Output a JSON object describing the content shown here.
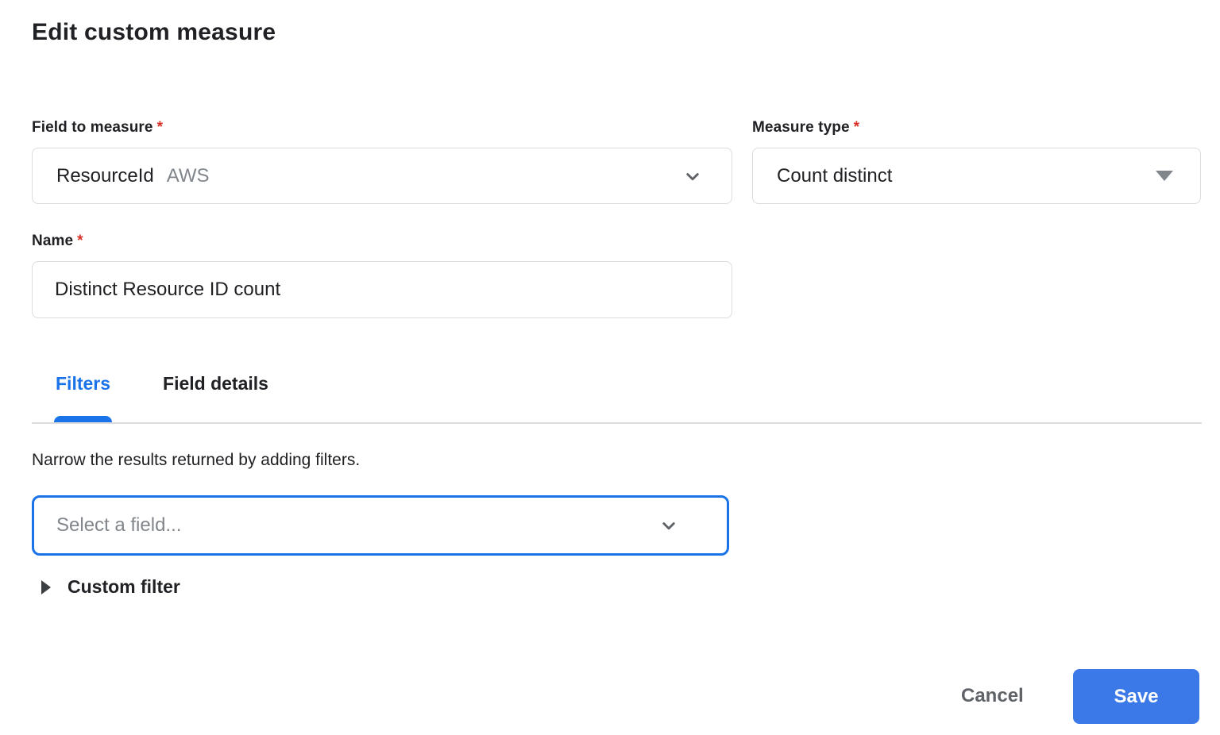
{
  "colors": {
    "accent_blue": "#1a73e8",
    "save_button_blue": "#3b78e8",
    "required_red": "#d93025",
    "border_gray": "#dadce0",
    "muted_text_gray": "#80868b",
    "secondary_text_gray": "#5f6368",
    "primary_text": "#202124"
  },
  "header": {
    "title": "Edit custom measure"
  },
  "form": {
    "field_to_measure": {
      "label": "Field to measure",
      "required_mark": "*",
      "value": "ResourceId",
      "value_suffix": "AWS",
      "dropdown_icon": "chevron-down"
    },
    "measure_type": {
      "label": "Measure type",
      "required_mark": "*",
      "value": "Count distinct",
      "dropdown_icon": "triangle-down"
    },
    "name": {
      "label": "Name",
      "required_mark": "*",
      "value": "Distinct Resource ID count"
    }
  },
  "tabs": [
    {
      "label": "Filters",
      "active": true
    },
    {
      "label": "Field details",
      "active": false
    }
  ],
  "filters_panel": {
    "description": "Narrow the results returned by adding filters.",
    "field_select_placeholder": "Select a field...",
    "custom_filter_label": "Custom filter",
    "custom_filter_expander_icon": "triangle-right"
  },
  "footer": {
    "cancel_label": "Cancel",
    "save_label": "Save"
  }
}
